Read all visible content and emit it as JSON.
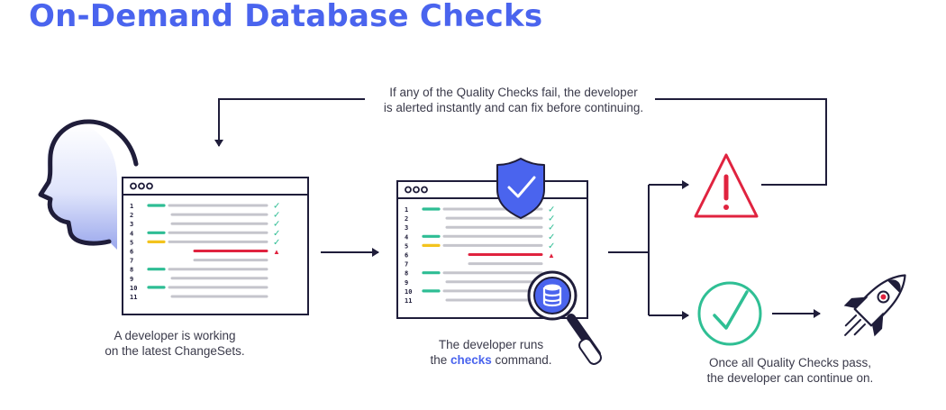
{
  "title": "On-Demand Database Checks",
  "feedback_caption": {
    "line1": "If any of the Quality Checks fail, the developer",
    "line2": "is alerted instantly and can fix before continuing."
  },
  "developer_caption": {
    "line1": "A developer is working",
    "line2": "on the latest ChangeSets."
  },
  "checks_caption": {
    "line1": "The developer runs",
    "line2_before": "the ",
    "line2_keyword": "checks",
    "line2_after": " command."
  },
  "success_caption": {
    "line1": "Once all Quality Checks pass,",
    "line2": "the developer can continue on."
  },
  "editor": {
    "window_dots": [
      "●",
      "●",
      "●"
    ],
    "line_numbers": [
      "1",
      "2",
      "3",
      "4",
      "5",
      "6",
      "7",
      "8",
      "9",
      "10",
      "11"
    ],
    "check_mark": "✓",
    "warning_mark": "▲"
  },
  "icons": [
    "head-silhouette-icon",
    "shield-check-icon",
    "magnifier-database-icon",
    "warning-triangle-icon",
    "success-check-circle-icon",
    "rocket-icon"
  ],
  "colors": {
    "brand_blue": "#4a64ee",
    "alert_red": "#e0233f",
    "success_green": "#2fbf94",
    "code_green": "#2ebd94",
    "code_yellow": "#f3c31d",
    "code_gray": "#c5c5cc",
    "outline_navy": "#1f1d3a"
  }
}
